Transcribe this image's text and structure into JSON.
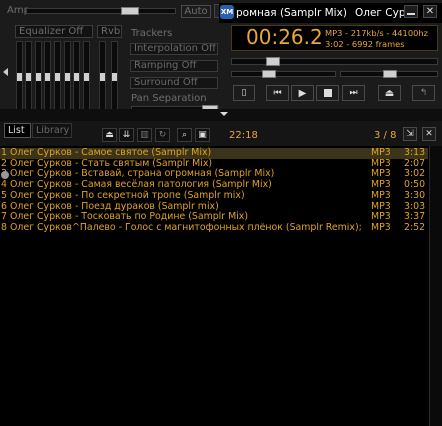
{
  "equalizer": {
    "amp_label": "Amp",
    "auto_label": "Auto",
    "eq_label": "Equalizer Off",
    "rvb_label": "Rvb"
  },
  "trackers": {
    "title": "Trackers",
    "interpolation": "Interpolation Off",
    "ramping": "Ramping Off",
    "surround": "Surround Off",
    "pan_label": "Pan Separation"
  },
  "player": {
    "time": "00:26.2",
    "title_scroll": "ромная (Samplr Mix)",
    "artist_scroll": "Олег Сур",
    "info_line1": "MP3 - 217kb/s - 44100hz",
    "info_line2": "3:02 - 6992 frames"
  },
  "playlist": {
    "tab_list": "List",
    "tab_library": "Library",
    "total_time": "22:18",
    "position": "3 / 8",
    "tracks": [
      {
        "title": "1 Олег Сурков - Самое святое (Samplr Mix)",
        "format": "MP3",
        "duration": "3:13",
        "selected": true
      },
      {
        "title": "2 Олег Сурков - Стать святым (Samplr Mix)",
        "format": "MP3",
        "duration": "2:07",
        "selected": false
      },
      {
        "title": "3 Олег Сурков - Вставай, страна огромная (Samplr Mix)",
        "format": "MP3",
        "duration": "3:02",
        "selected": false
      },
      {
        "title": "4 Олег Сурков - Самая весёлая патология (Samplr Mix)",
        "format": "MP3",
        "duration": "0:50",
        "selected": false
      },
      {
        "title": "5 Олег Сурков - По секретной тропе (Samplr mix)",
        "format": "MP3",
        "duration": "3:30",
        "selected": false
      },
      {
        "title": "6 Олег Сурков - Поезд дураков (Samplr mix)",
        "format": "MP3",
        "duration": "3:03",
        "selected": false
      },
      {
        "title": "7 Олег Сурков - Тосковать по Родине (Samplr Mix)",
        "format": "MP3",
        "duration": "3:37",
        "selected": false
      },
      {
        "title": "8 Олег Сурков^Палево - Голос с магнитофонных плёнок (Samplr Remix);",
        "format": "MP3",
        "duration": "2:52",
        "selected": false
      }
    ]
  },
  "colors": {
    "track_text": "#e1a321",
    "selected_row": "#3c3418",
    "time_text": "#e9a63c",
    "background": "#000000"
  },
  "seek_position_fraction": 0.18,
  "volume_fraction": 0.42
}
